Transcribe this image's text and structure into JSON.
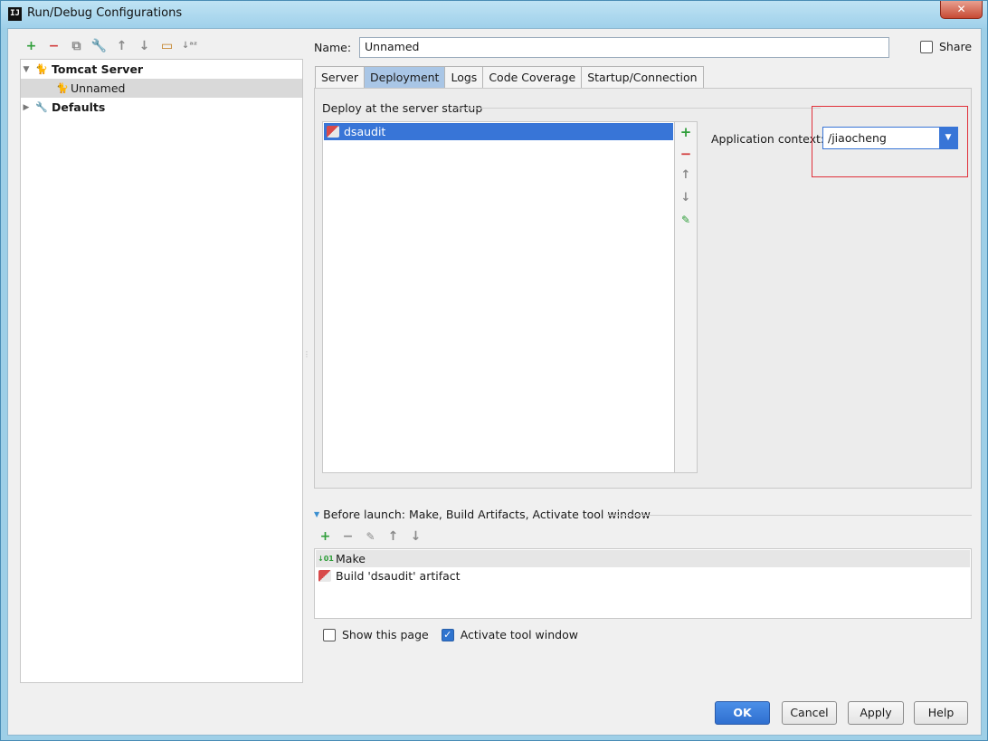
{
  "window": {
    "title": "Run/Debug Configurations",
    "title_icon_text": "IJ",
    "close_glyph": "✕"
  },
  "left_toolbar": {
    "icons": [
      "add-icon",
      "remove-icon",
      "copy-icon",
      "edit-defaults-icon",
      "move-up-icon",
      "move-down-icon",
      "folder-icon",
      "sort-icon"
    ]
  },
  "tree": {
    "items": [
      {
        "label": "Tomcat Server",
        "bold": true,
        "expanded": true
      },
      {
        "label": "Unnamed",
        "selected": true
      },
      {
        "label": "Defaults",
        "bold": true,
        "expanded": false
      }
    ]
  },
  "name": {
    "label": "Name:",
    "value": "Unnamed",
    "share_label": "Share",
    "share_checked": false
  },
  "tabs": [
    {
      "label": "Server",
      "active": false
    },
    {
      "label": "Deployment",
      "active": true
    },
    {
      "label": "Logs",
      "active": false
    },
    {
      "label": "Code Coverage",
      "active": false
    },
    {
      "label": "Startup/Connection",
      "active": false
    }
  ],
  "deployment": {
    "section_label": "Deploy at the server startup",
    "items": [
      "dsaudit"
    ],
    "application_context_label": "Application context:",
    "application_context_value": "/jiaocheng"
  },
  "before_launch": {
    "label": "Before launch: Make, Build Artifacts, Activate tool window",
    "items": [
      "Make",
      "Build 'dsaudit' artifact"
    ]
  },
  "options": {
    "show_this_page_label": "Show this page",
    "show_this_page_checked": false,
    "activate_tool_window_label": "Activate tool window",
    "activate_tool_window_checked": true
  },
  "buttons": {
    "ok": "OK",
    "cancel": "Cancel",
    "apply": "Apply",
    "help": "Help"
  },
  "colors": {
    "selection": "#3875d7",
    "highlight_box": "#e0303a",
    "ok_button": "#2f6fd0"
  }
}
